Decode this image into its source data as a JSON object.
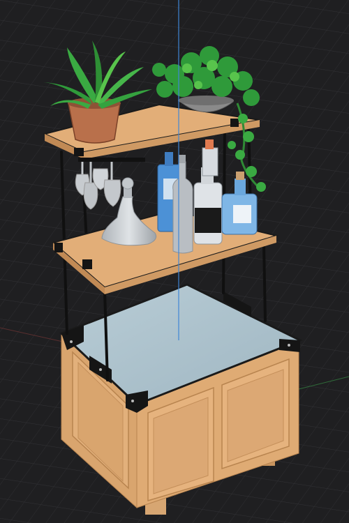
{
  "viewport": {
    "background": "#1f1f21",
    "grid_color": "#2e2e31",
    "axis_x_color": "#8a3a3a",
    "axis_y_color": "#2f6b3a",
    "axis_z_color": "#3f86d6"
  },
  "model": {
    "wood_color": "#e0ad78",
    "wood_shade": "#c18a55",
    "metal_color": "#141414",
    "countertop_color": "#a8bfcb",
    "glass_color": "#c9ccd0",
    "pot_color": "#b36a47",
    "bowl_color": "#8a8a8a",
    "leaf_color": "#2f9a3a",
    "leaf_highlight": "#58c44c",
    "bottle_blue": "#4a90d9",
    "bottle_clear": "#d6dce3"
  }
}
